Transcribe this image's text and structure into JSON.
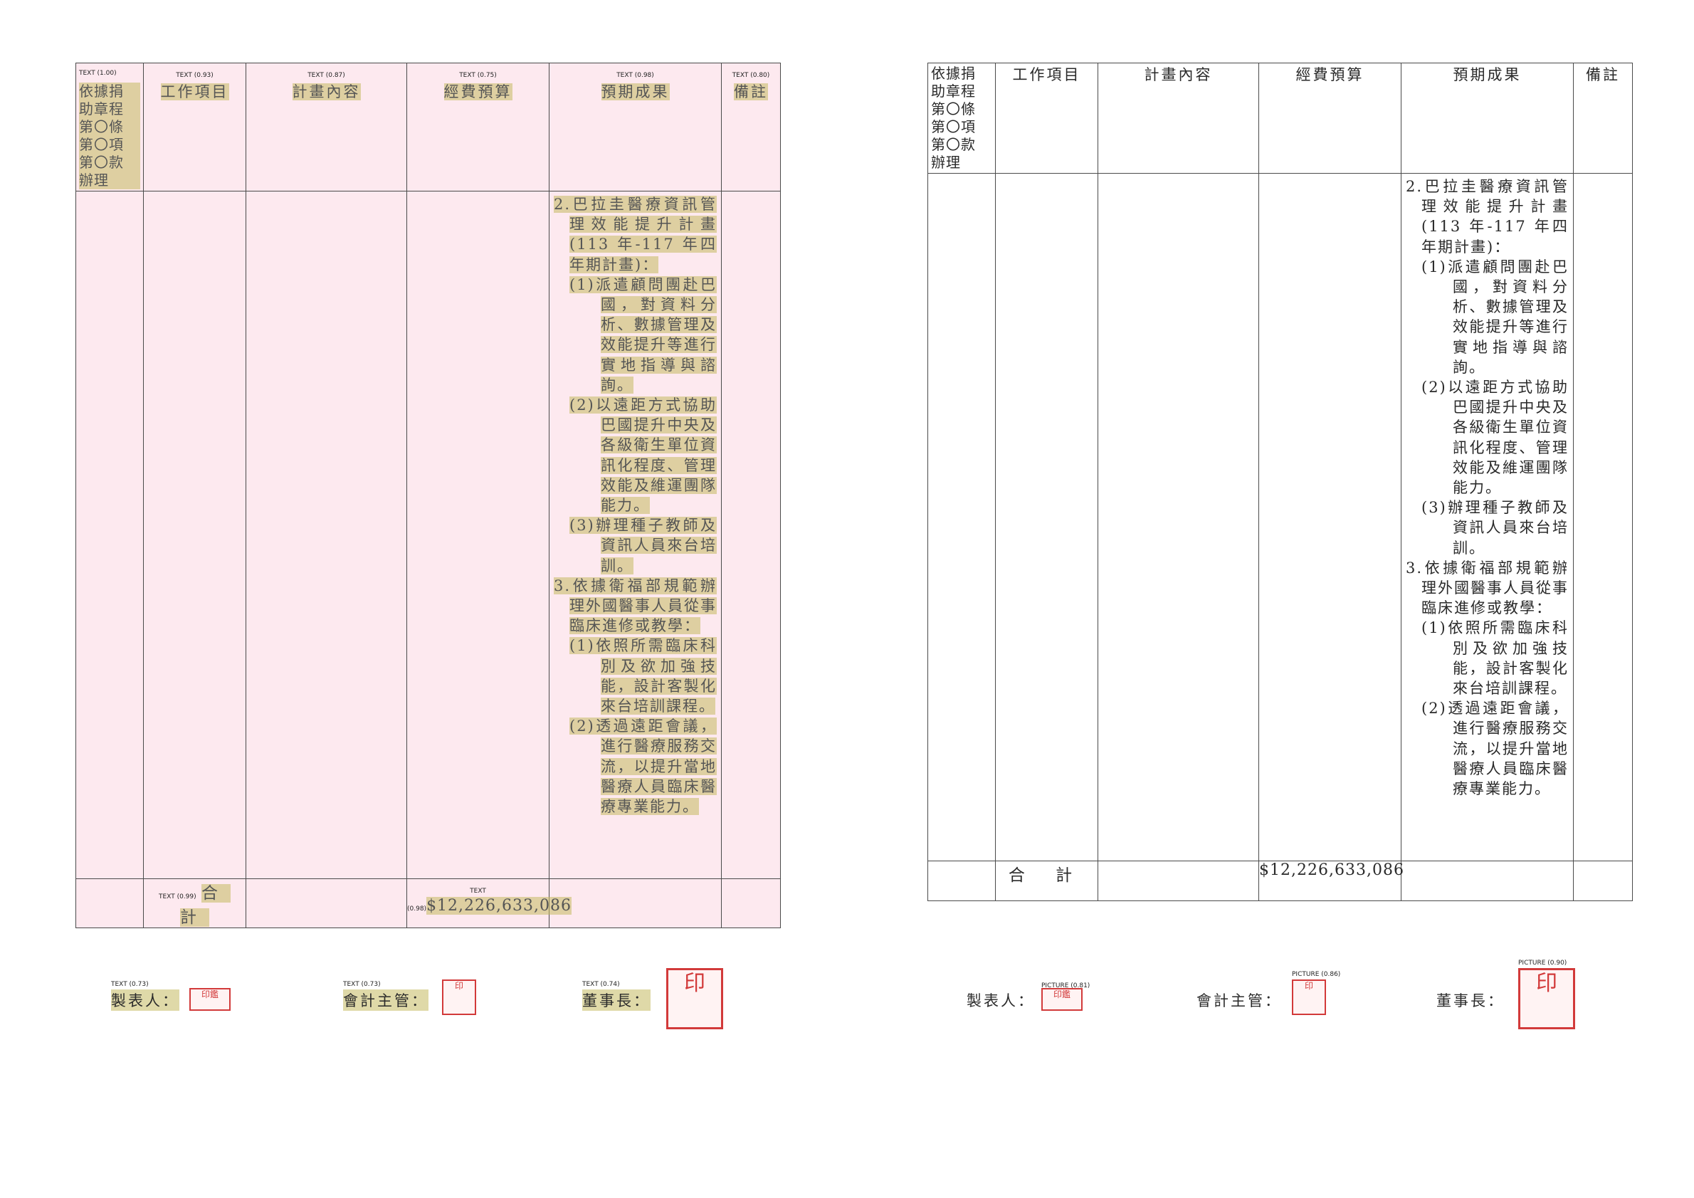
{
  "table": {
    "headers": {
      "basis_lines": [
        "依據捐",
        "助章程",
        "第〇條",
        "第〇項",
        "第〇款",
        "辦理"
      ],
      "work_item": "工作項目",
      "plan_content": "計畫內容",
      "budget": "經費預算",
      "expected_results": "預期成果",
      "remarks": "備註"
    },
    "outcomes": [
      {
        "level": 1,
        "text": "2.巴拉圭醫療資訊管理效能提升計畫(113 年-117 年四年期計畫)："
      },
      {
        "level": 2,
        "text": "(1)派遣顧問團赴巴國，對資料分析、數據管理及效能提升等進行實地指導與諮詢。"
      },
      {
        "level": 2,
        "text": "(2)以遠距方式協助巴國提升中央及各級衛生單位資訊化程度、管理效能及維運團隊能力。"
      },
      {
        "level": 2,
        "text": "(3)辦理種子教師及資訊人員來台培訓。"
      },
      {
        "level": 1,
        "text": "3.依據衛福部規範辦理外國醫事人員從事臨床進修或教學："
      },
      {
        "level": 2,
        "text": "(1)依照所需臨床科別及欲加強技能，設計客製化來台培訓課程。"
      },
      {
        "level": 2,
        "text": "(2)透過遠距會議，進行醫療服務交流，以提升當地醫療人員臨床醫療專業能力。"
      }
    ],
    "total_label": "合 計",
    "total_amount": "$12,226,633,086"
  },
  "signatures": {
    "preparer": "製表人：",
    "accounting_supervisor": "會計主管：",
    "chairman": "董事長："
  },
  "stamps": {
    "preparer_seal": "印鑑",
    "accountant_seal": "印",
    "chairman_seal": "印"
  },
  "ocr_overlay": {
    "header_tags": [
      "TEXT (1.00)",
      "TEXT (0.93)",
      "TEXT (0.87)",
      "TEXT (0.75)",
      "TEXT (0.98)",
      "TEXT (0.80)"
    ],
    "total_tags": [
      "TEXT (0.99)",
      "TEXT (0.98)"
    ],
    "sign_tags": [
      "TEXT (0.73)",
      "TEXT (0.73)",
      "TEXT (0.74)"
    ],
    "picture_tags": [
      "PICTURE (0.81)",
      "PICTURE (0.86)",
      "PICTURE (0.90)"
    ]
  },
  "colors": {
    "highlight": "#c4ba60",
    "left_page_tint": "#fde9ef",
    "stamp_red": "#d23a3a"
  }
}
